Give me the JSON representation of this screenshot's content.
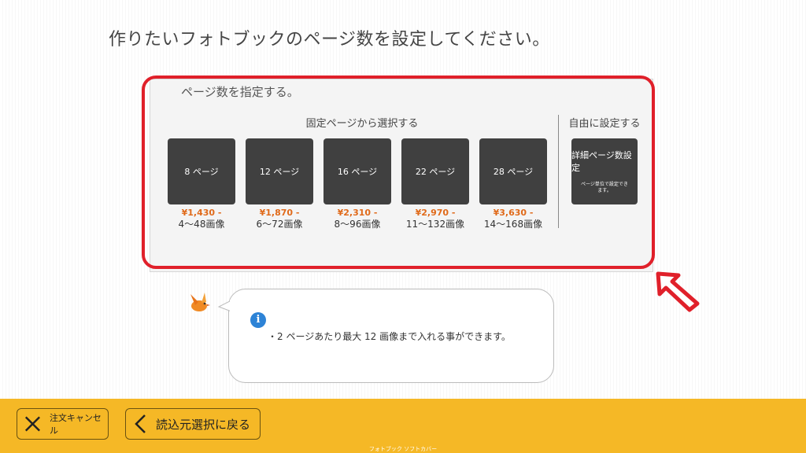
{
  "page": {
    "title": "作りたいフォトブックのページ数を設定してください。"
  },
  "panel": {
    "heading": "ページ数を指定する。",
    "fixed_label": "固定ページから選択する",
    "free_label": "自由に設定する",
    "options": [
      {
        "label": "8 ページ",
        "price": "¥1,430 -",
        "images": "4～48画像"
      },
      {
        "label": "12 ページ",
        "price": "¥1,870 -",
        "images": "6～72画像"
      },
      {
        "label": "16 ページ",
        "price": "¥2,310 -",
        "images": "8～96画像"
      },
      {
        "label": "22 ページ",
        "price": "¥2,970 -",
        "images": "11～132画像"
      },
      {
        "label": "28 ページ",
        "price": "¥3,630 -",
        "images": "14～168画像"
      }
    ],
    "detail": {
      "title": "詳細ページ数設定",
      "subtitle": "ページ単位で設定できます。"
    }
  },
  "info": {
    "text": "・2 ページあたり最大 12 画像まで入れる事ができます。"
  },
  "footer": {
    "cancel_label": "注文キャンセル",
    "back_label": "読込元選択に戻る",
    "caption": "フォトブック ソフトカバー"
  },
  "colors": {
    "accent": "#f5b826",
    "highlight": "#e0202a",
    "price": "#e06a1a",
    "button": "#404040",
    "info": "#2d83d6"
  },
  "icons": [
    "close-icon",
    "chevron-left-icon",
    "info-icon",
    "arrow-pointer-icon",
    "bird-mascot-icon"
  ]
}
